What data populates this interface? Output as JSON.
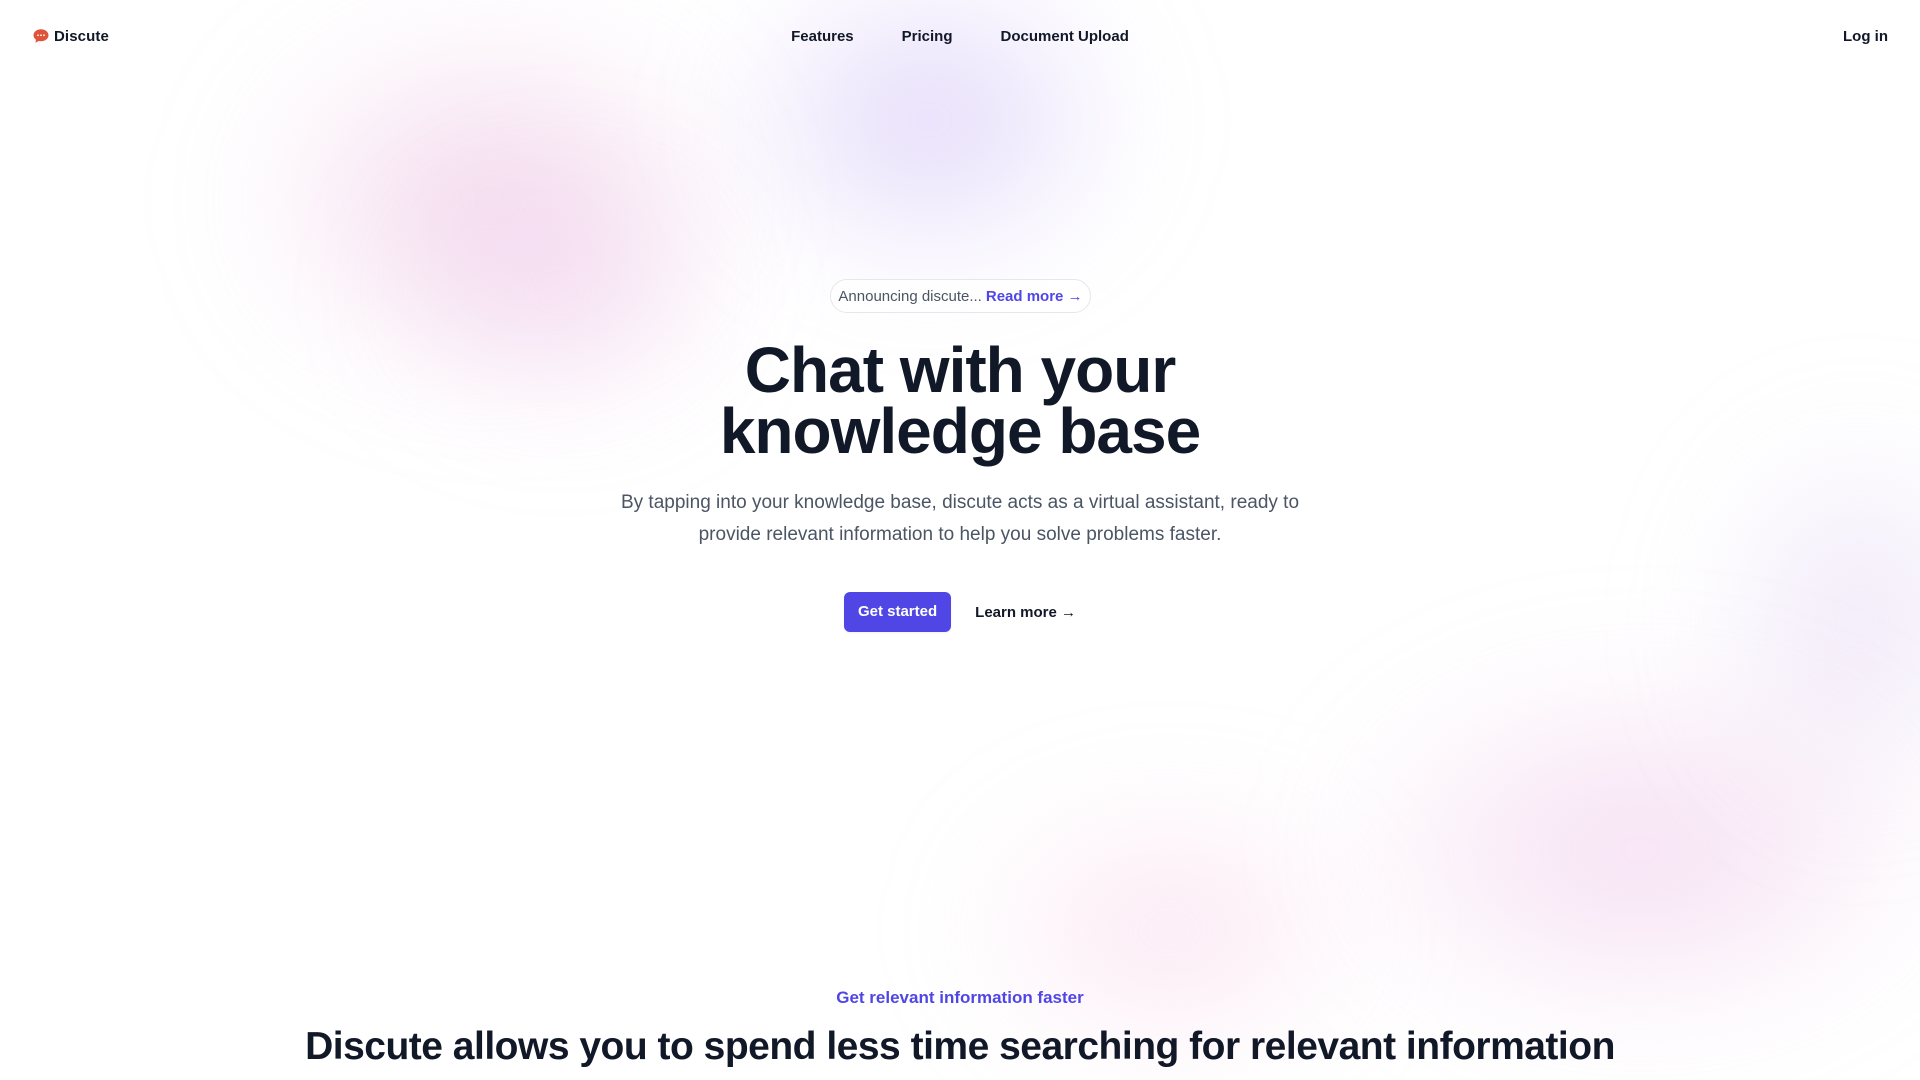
{
  "header": {
    "brand_name": "Discute",
    "brand_icon": "chat-bubble-icon",
    "brand_icon_color": "#e0533b",
    "nav": [
      {
        "label": "Features"
      },
      {
        "label": "Pricing"
      },
      {
        "label": "Document Upload"
      }
    ],
    "login_label": "Log in"
  },
  "hero": {
    "announcement_text": "Announcing discute...",
    "announcement_link": "Read more →",
    "title_line1": "Chat with your",
    "title_line2": "knowledge base",
    "subtitle": "By tapping into your knowledge base, discute acts as a virtual assistant, ready to provide relevant information to help you solve problems faster.",
    "primary_cta": "Get started",
    "secondary_cta": "Learn more →"
  },
  "features": {
    "eyebrow": "Get relevant information faster",
    "title": "Discute allows you to spend less time searching for relevant information"
  },
  "colors": {
    "accent": "#4f46e5",
    "text": "#111827",
    "muted": "#4b5563"
  }
}
